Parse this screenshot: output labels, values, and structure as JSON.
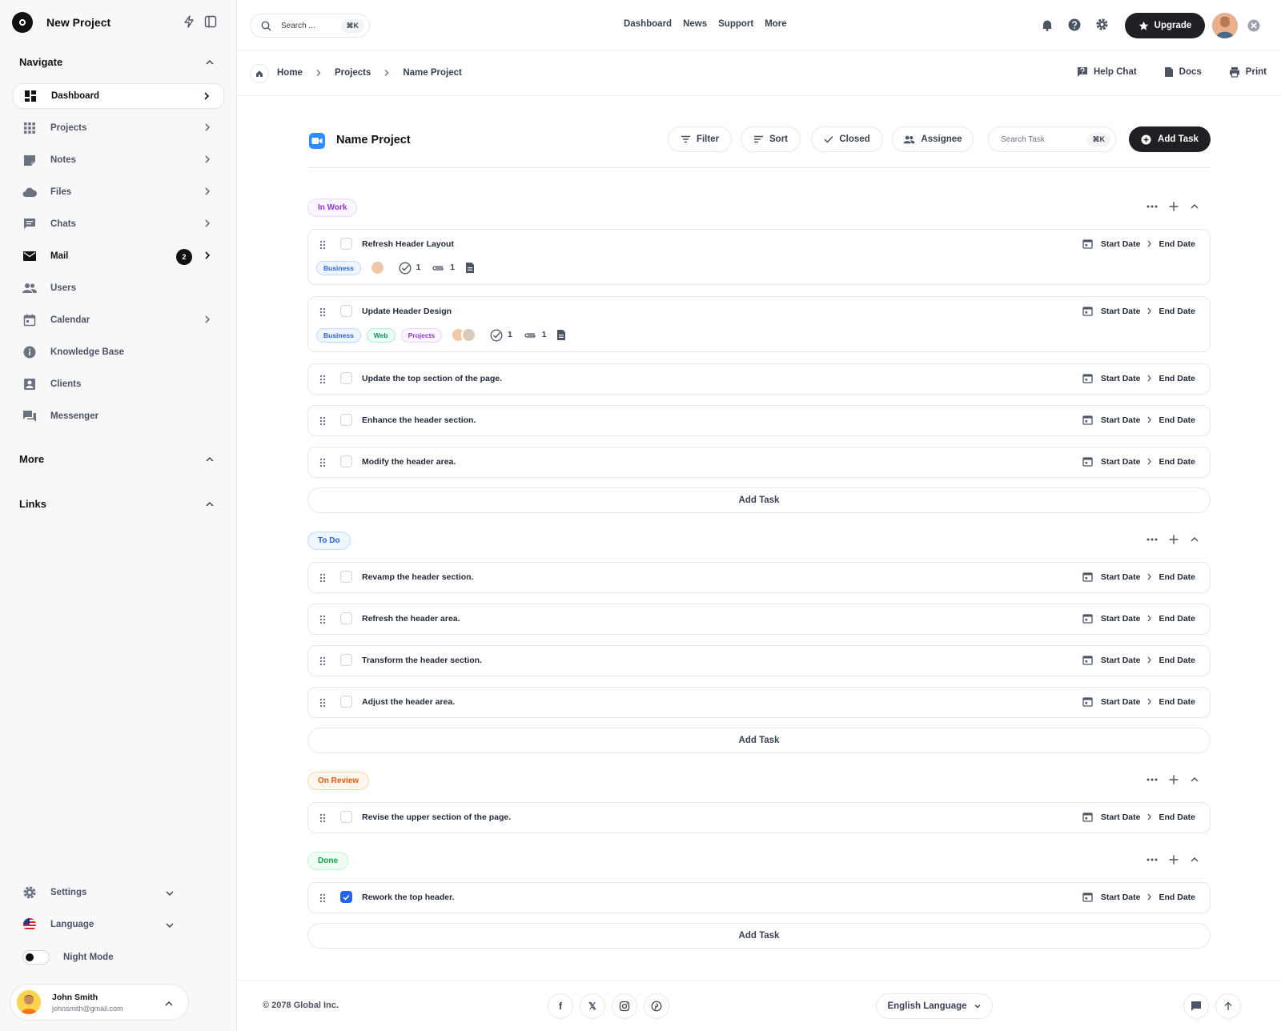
{
  "app": {
    "name": "New Project"
  },
  "sidebar": {
    "navigate_label": "Navigate",
    "items": [
      {
        "label": "Dashboard",
        "icon": "dashboard-icon"
      },
      {
        "label": "Projects",
        "icon": "grid-icon"
      },
      {
        "label": "Notes",
        "icon": "note-icon"
      },
      {
        "label": "Files",
        "icon": "cloud-icon"
      },
      {
        "label": "Chats",
        "icon": "chat-icon"
      },
      {
        "label": "Mail",
        "icon": "mail-icon",
        "badge": "2"
      },
      {
        "label": "Users",
        "icon": "users-icon"
      },
      {
        "label": "Calendar",
        "icon": "calendar-icon"
      },
      {
        "label": "Knowledge Base",
        "icon": "info-icon"
      },
      {
        "label": "Clients",
        "icon": "contact-icon"
      },
      {
        "label": "Messenger",
        "icon": "messenger-icon"
      }
    ],
    "more_label": "More",
    "links_label": "Links",
    "settings_label": "Settings",
    "language_label": "Language",
    "night_mode_label": "Night Mode",
    "user": {
      "name": "John Smith",
      "email": "johnsmith@gmail.com"
    }
  },
  "header": {
    "search_placeholder": "Search ...",
    "search_shortcut": "⌘K",
    "nav": [
      "Dashboard",
      "News",
      "Support",
      "More"
    ],
    "upgrade_label": "Upgrade"
  },
  "breadcrumb": {
    "items": [
      "Home",
      "Projects",
      "Name Project"
    ],
    "actions": {
      "help_chat": "Help Chat",
      "docs": "Docs",
      "print": "Print"
    }
  },
  "project": {
    "title": "Name Project",
    "filter_label": "Filter",
    "sort_label": "Sort",
    "closed_label": "Closed",
    "assignee_label": "Assignee",
    "search_task_placeholder": "Search Task",
    "search_task_shortcut": "⌘K",
    "add_task_label": "Add Task"
  },
  "task_labels": {
    "start_date": "Start Date",
    "end_date": "End Date",
    "add_task": "Add Task"
  },
  "groups": [
    {
      "status": "In Work",
      "tasks": [
        {
          "name": "Refresh Header Layout",
          "tags": [
            "Business"
          ],
          "checks": "1",
          "attachments": "1"
        },
        {
          "name": "Update Header Design",
          "tags": [
            "Business",
            "Web",
            "Projects"
          ],
          "checks": "1",
          "attachments": "1"
        },
        {
          "name": "Update the top section of the page."
        },
        {
          "name": "Enhance the header section."
        },
        {
          "name": "Modify the header area."
        }
      ]
    },
    {
      "status": "To Do",
      "tasks": [
        {
          "name": "Revamp the header section."
        },
        {
          "name": "Refresh the header area."
        },
        {
          "name": "Transform the header section."
        },
        {
          "name": "Adjust the header area."
        }
      ]
    },
    {
      "status": "On Review",
      "tasks": [
        {
          "name": "Revise the upper section of the page."
        }
      ]
    },
    {
      "status": "Done",
      "tasks": [
        {
          "name": "Rework the top header.",
          "checked": true
        }
      ]
    }
  ],
  "footer": {
    "copyright": "© 2078 Global Inc.",
    "social": [
      "f",
      "𝕏",
      "ig",
      "p"
    ],
    "language": "English Language"
  },
  "colors": {
    "accent_dark": "#1f2024",
    "in_work": "#9333ea",
    "to_do": "#2563eb",
    "on_review": "#ea580c",
    "done": "#16a34a"
  }
}
